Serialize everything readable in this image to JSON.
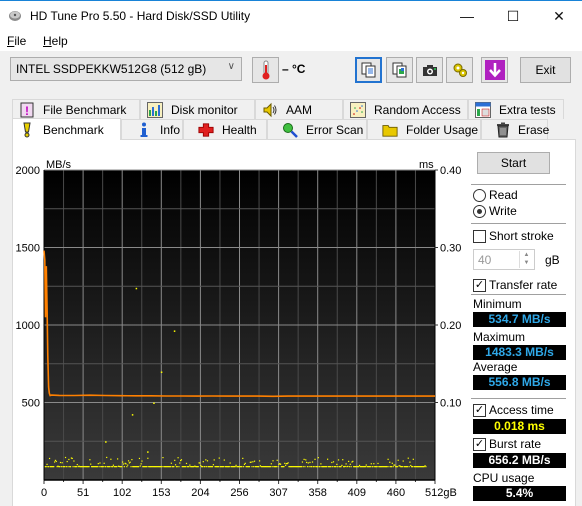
{
  "window": {
    "title": "HD Tune Pro 5.50 - Hard Disk/SSD Utility",
    "minimize_glyph": "—",
    "maximize_glyph": "☐",
    "close_glyph": "✕"
  },
  "menu": {
    "items": [
      {
        "label": "File",
        "accel": "F",
        "rest": "ile"
      },
      {
        "label": "Help",
        "accel": "H",
        "rest": "elp"
      }
    ]
  },
  "toolbar": {
    "drive": "INTEL SSDPEKKW512G8 (512 gB)",
    "temperature": "– °C",
    "buttons": [
      "copy-text-icon",
      "copy-screenshot-icon",
      "camera-icon",
      "options-icon",
      "save-download-icon"
    ],
    "exit_label": "Exit"
  },
  "tabs": {
    "top_row": [
      {
        "label": "File Benchmark",
        "icon": "file-benchmark-icon"
      },
      {
        "label": "Disk monitor",
        "icon": "disk-monitor-icon"
      },
      {
        "label": "AAM",
        "icon": "speaker-icon"
      },
      {
        "label": "Random Access",
        "icon": "random-access-icon"
      },
      {
        "label": "Extra tests",
        "icon": "extra-tests-icon"
      }
    ],
    "bottom_row": [
      {
        "label": "Benchmark",
        "icon": "exclamation-icon",
        "selected": true
      },
      {
        "label": "Info",
        "icon": "info-icon"
      },
      {
        "label": "Health",
        "icon": "health-cross-icon"
      },
      {
        "label": "Error Scan",
        "icon": "magnifier-icon"
      },
      {
        "label": "Folder Usage",
        "icon": "folder-icon"
      },
      {
        "label": "Erase",
        "icon": "trash-icon"
      }
    ]
  },
  "controls": {
    "start_label": "Start",
    "read_label": "Read",
    "write_label": "Write",
    "mode_selected": "Write",
    "short_stroke_label": "Short stroke",
    "short_stroke_checked": false,
    "short_stroke_value": "40",
    "short_stroke_unit": "gB",
    "transfer_rate_label": "Transfer rate",
    "transfer_rate_checked": true,
    "minimum_label": "Minimum",
    "minimum_value": "534.7 MB/s",
    "maximum_label": "Maximum",
    "maximum_value": "1483.3 MB/s",
    "average_label": "Average",
    "average_value": "556.8 MB/s",
    "access_time_label": "Access time",
    "access_time_checked": true,
    "access_time_value": "0.018 ms",
    "burst_rate_label": "Burst rate",
    "burst_rate_checked": true,
    "burst_rate_value": "656.2 MB/s",
    "cpu_usage_label": "CPU usage",
    "cpu_usage_value": "5.4%",
    "colors": {
      "transfer_text": "#2fa8e8",
      "access_text": "#ffff00",
      "white_text": "#ffffff"
    }
  },
  "chart_data": {
    "type": "line",
    "title": "",
    "xlabel": "gB",
    "ylabel": "MB/s",
    "y2label": "ms",
    "xlim": [
      0,
      512
    ],
    "ylim": [
      0,
      2000
    ],
    "y2lim": [
      0,
      0.4
    ],
    "x_ticks": [
      "0",
      "51",
      "102",
      "153",
      "204",
      "256",
      "307",
      "358",
      "409",
      "460",
      "512gB"
    ],
    "y_ticks": [
      "2000",
      "1500",
      "1000",
      "500"
    ],
    "y2_ticks": [
      "0.40",
      "0.30",
      "0.20",
      "0.10"
    ],
    "grid": true,
    "series": [
      {
        "name": "Transfer rate (Write)",
        "color": "#ff8000",
        "axis": "left",
        "x": [
          0,
          1,
          2,
          3,
          4,
          5,
          6,
          7,
          8,
          10,
          20,
          40,
          60,
          80,
          100,
          120,
          140,
          160,
          180,
          200,
          220,
          240,
          260,
          280,
          300,
          320,
          340,
          360,
          380,
          400,
          420,
          440,
          460,
          480,
          500,
          512
        ],
        "y": [
          1480,
          1420,
          1050,
          1380,
          1100,
          800,
          600,
          560,
          545,
          548,
          546,
          545,
          547,
          545,
          544,
          543,
          543,
          542,
          542,
          541,
          542,
          541,
          541,
          541,
          540,
          541,
          541,
          541,
          541,
          541,
          541,
          541,
          541,
          541,
          541,
          541
        ]
      },
      {
        "name": "Access time",
        "color": "#ffff00",
        "axis": "right",
        "type": "scatter",
        "baseline_ms": 0.018,
        "outliers": [
          {
            "x": 120,
            "y_ms": 0.248
          },
          {
            "x": 170,
            "y_ms": 0.193
          },
          {
            "x": 153,
            "y_ms": 0.14
          },
          {
            "x": 143,
            "y_ms": 0.1
          },
          {
            "x": 115,
            "y_ms": 0.085
          },
          {
            "x": 80,
            "y_ms": 0.05
          },
          {
            "x": 135,
            "y_ms": 0.037
          }
        ]
      }
    ]
  }
}
